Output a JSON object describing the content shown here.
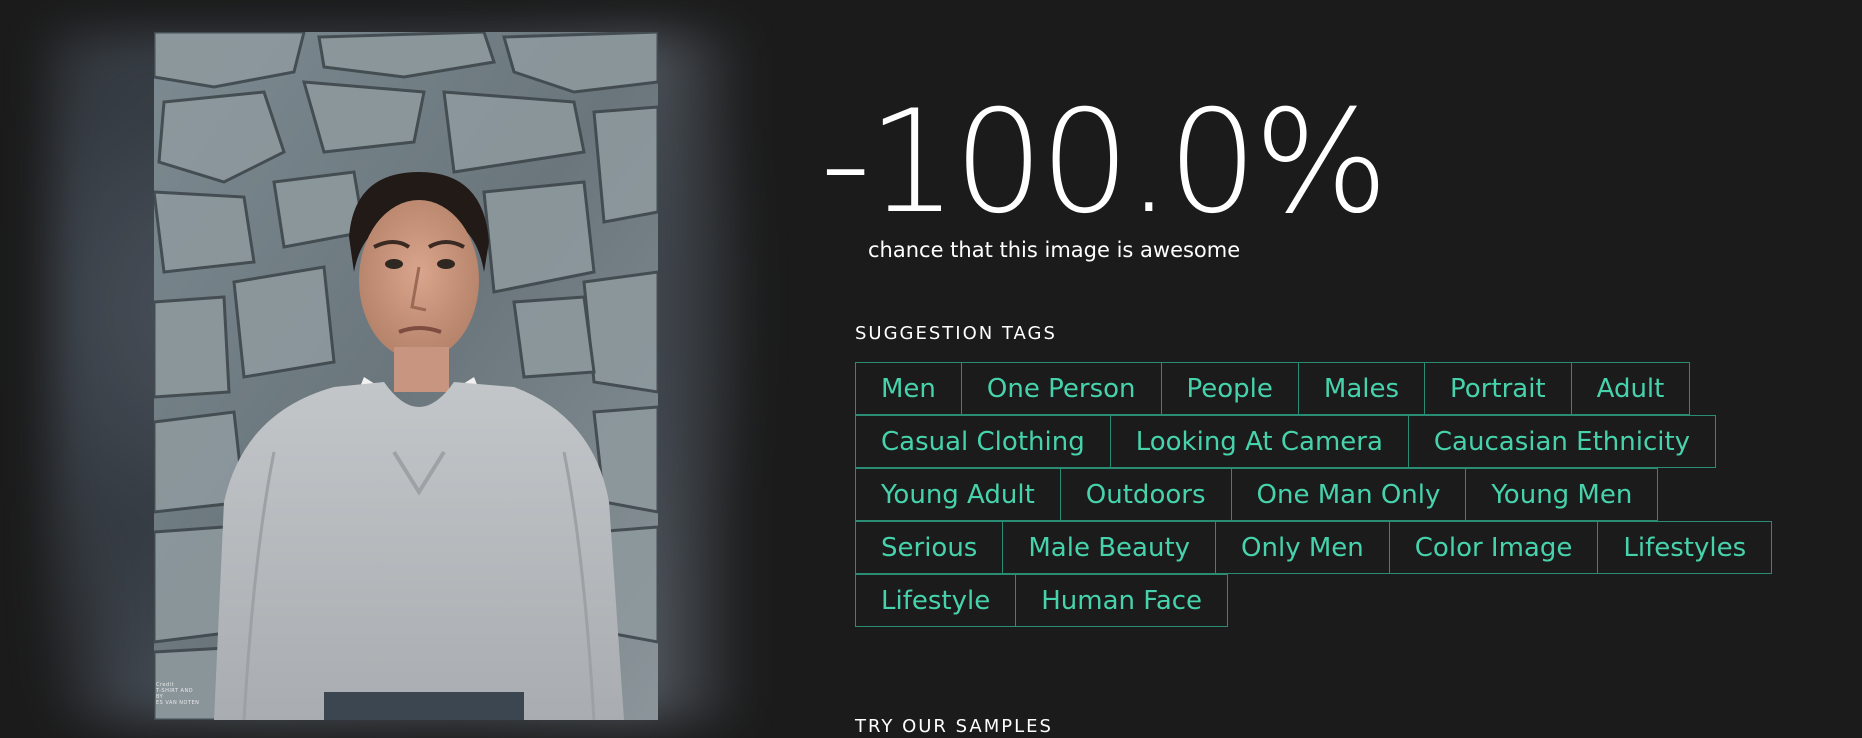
{
  "score": {
    "value": "-100.0%",
    "caption": "chance that this image is awesome"
  },
  "image": {
    "credit_text": "Credit\nT-SHIRT AND\nBY\nES VAN NOTEN"
  },
  "suggestion_tags": {
    "title": "SUGGESTION TAGS",
    "rows": [
      [
        "Men",
        "One Person",
        "People",
        "Males",
        "Portrait",
        "Adult"
      ],
      [
        "Casual Clothing",
        "Looking At Camera",
        "Caucasian Ethnicity"
      ],
      [
        "Young Adult",
        "Outdoors",
        "One Man Only",
        "Young Men"
      ],
      [
        "Serious",
        "Male Beauty",
        "Only Men",
        "Color Image",
        "Lifestyles"
      ],
      [
        "Lifestyle",
        "Human Face"
      ]
    ]
  },
  "samples": {
    "title": "TRY OUR SAMPLES"
  },
  "colors": {
    "background": "#1b1b1b",
    "tag_text": "#46d3ac",
    "tag_border": "#2a8c73",
    "text": "#ffffff"
  }
}
